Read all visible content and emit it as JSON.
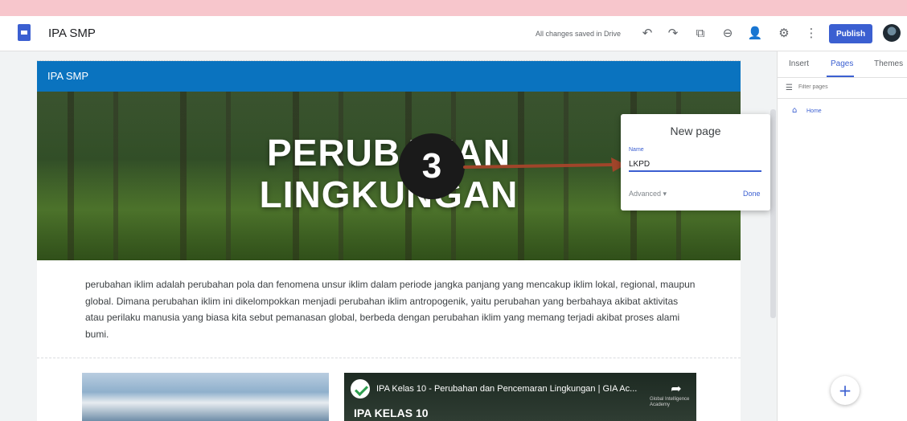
{
  "app": {
    "title": "IPA SMP",
    "saved_status": "All changes saved in Drive"
  },
  "toolbar": {
    "undo_glyph": "↶",
    "redo_glyph": "↷",
    "preview_glyph": "⧉",
    "link_glyph": "⊖",
    "share_glyph": "👤",
    "settings_glyph": "⚙",
    "more_glyph": "⋮",
    "publish_label": "Publish"
  },
  "page": {
    "site_name": "IPA SMP",
    "hero_title_line1": "PERUBAHAN",
    "hero_title_line2": "LINGKUNGAN",
    "paragraph": "perubahan iklim adalah perubahan pola dan fenomena unsur iklim dalam periode jangka panjang yang mencakup iklim lokal, regional, maupun global. Dimana perubahan iklim ini dikelompokkan menjadi perubahan iklim antropogenik, yaitu perubahan yang berbahaya akibat aktivitas atau perilaku manusia yang biasa kita sebut pemanasan global, berbeda dengan perubahan iklim yang memang terjadi akibat proses alami bumi.",
    "video": {
      "title": "IPA Kelas 10 - Perubahan dan Pencemaran Lingkungan | GIA Ac...",
      "subtitle": "IPA KELAS 10",
      "brand": "Global Intelligence Academy"
    }
  },
  "dialog": {
    "title": "New page",
    "name_label": "Name",
    "name_value": "LKPD",
    "advanced_label": "Advanced ▾",
    "done_label": "Done"
  },
  "marker": {
    "number": "3"
  },
  "panel": {
    "tabs": [
      {
        "label": "Insert"
      },
      {
        "label": "Pages"
      },
      {
        "label": "Themes"
      }
    ],
    "filter_placeholder": "Filter pages",
    "pages": [
      {
        "label": "Home"
      }
    ],
    "add_glyph": "+"
  },
  "colors": {
    "accent": "#3b5fd1",
    "site_bar": "#0a73bf",
    "arrow": "#a0452a"
  }
}
